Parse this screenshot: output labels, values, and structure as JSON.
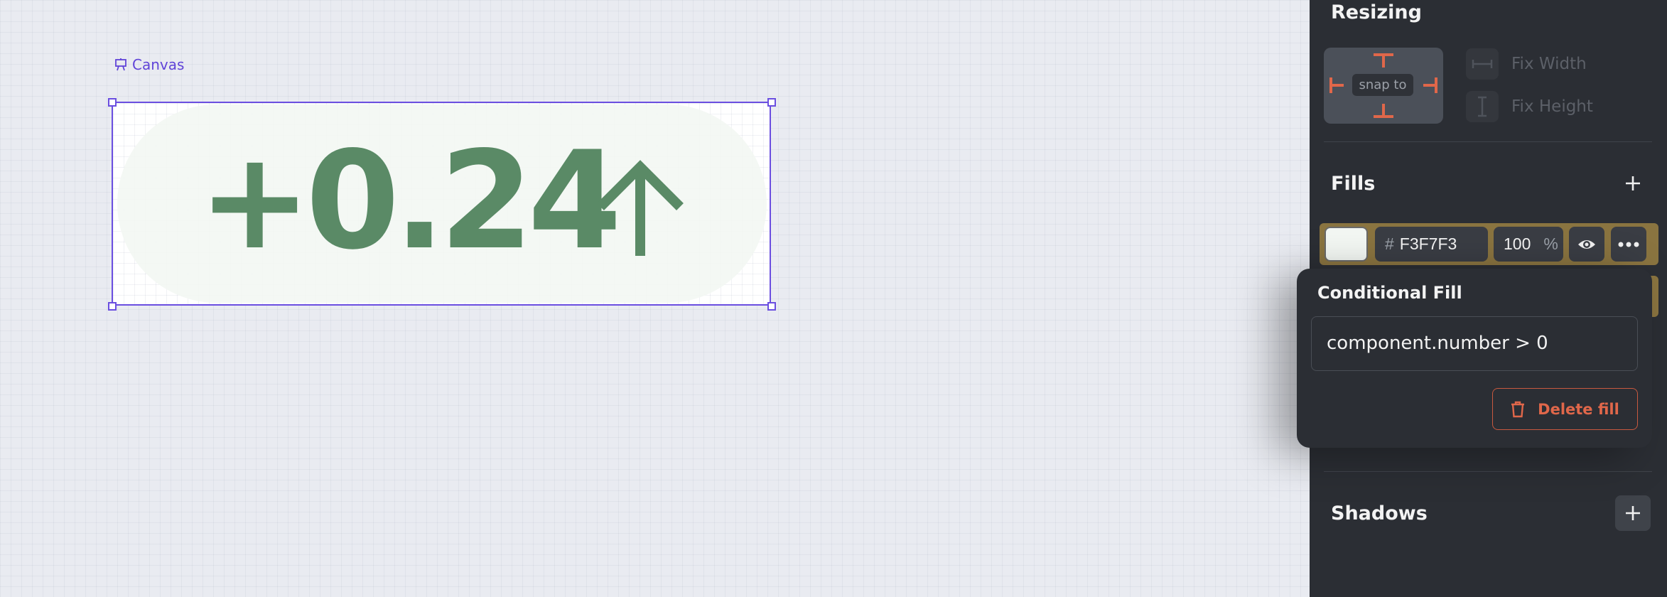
{
  "canvas": {
    "label": "Canvas",
    "component": {
      "value_text": "+0.24",
      "fill_color": "#F3F7F3",
      "text_color": "#5A8A66",
      "arrow_icon": "arrow-up-icon"
    }
  },
  "panel": {
    "resizing": {
      "title": "Resizing",
      "snap_label": "snap to",
      "fix_width": "Fix Width",
      "fix_height": "Fix Height"
    },
    "fills": {
      "title": "Fills",
      "add_icon": "plus-icon",
      "row": {
        "hash": "#",
        "hex": "F3F7F3",
        "opacity": "100",
        "percent": "%",
        "visibility_icon": "eye-icon",
        "more_icon": "more-icon"
      }
    },
    "shadows": {
      "title": "Shadows",
      "add_icon": "plus-icon"
    }
  },
  "popover": {
    "title": "Conditional Fill",
    "condition": "component.number > 0",
    "delete_label": "Delete fill",
    "delete_icon": "trash-icon"
  },
  "colors": {
    "accent": "#6A4EE0",
    "danger": "#E0674A",
    "highlight": "#8A7440",
    "panel_bg": "#2B2E34"
  }
}
